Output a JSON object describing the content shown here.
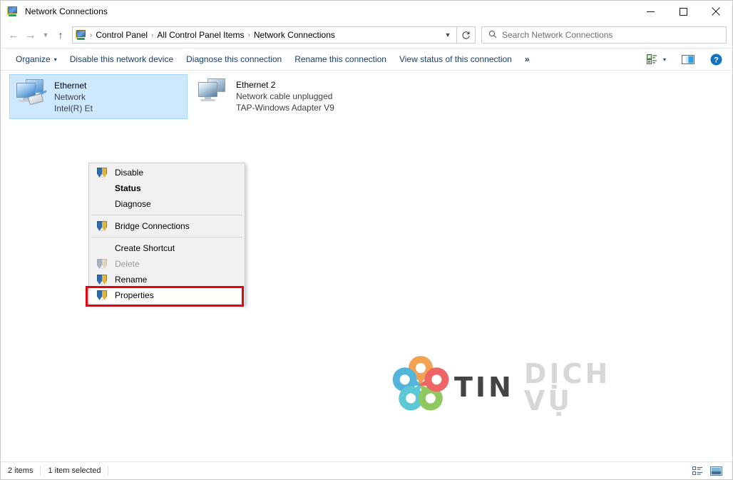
{
  "window": {
    "title": "Network Connections",
    "title_icon": "network-connections-icon",
    "minimize": "minimize-icon",
    "maximize": "maximize-icon",
    "close": "close-icon"
  },
  "navigation": {
    "back": "back-arrow-icon",
    "forward": "forward-arrow-icon",
    "recent": "recent-locations-icon",
    "up": "up-arrow-icon",
    "breadcrumb": {
      "icon": "network-connections-icon",
      "segments": [
        "Control Panel",
        "All Control Panel Items",
        "Network Connections"
      ],
      "separator": "›",
      "dropdown": "chevron-down-icon"
    },
    "refresh": "refresh-icon"
  },
  "search": {
    "icon": "search-icon",
    "placeholder": "Search Network Connections",
    "value": ""
  },
  "command_bar": {
    "organize": "Organize",
    "organize_caret": "▾",
    "items": [
      "Disable this network device",
      "Diagnose this connection",
      "Rename this connection",
      "View status of this connection"
    ],
    "overflow": "»",
    "change_view_icon": "change-view-icon",
    "change_view_caret": "▾",
    "preview_pane_icon": "preview-pane-icon",
    "help_icon": "help-icon"
  },
  "connections": [
    {
      "name": "Ethernet",
      "status": "Network",
      "device": "Intel(R) Et",
      "icon": "network-adapter-icon",
      "selected": true
    },
    {
      "name": "Ethernet 2",
      "status": "Network cable unplugged",
      "device": "TAP-Windows Adapter V9",
      "icon": "network-adapter-disconnected-icon",
      "selected": false
    }
  ],
  "context_menu": {
    "items": [
      {
        "label": "Disable",
        "icon": "uac-shield-icon",
        "bold": false,
        "disabled": false,
        "highlighted": false,
        "separator_after": false
      },
      {
        "label": "Status",
        "icon": "none",
        "bold": true,
        "disabled": false,
        "highlighted": false,
        "separator_after": false
      },
      {
        "label": "Diagnose",
        "icon": "none",
        "bold": false,
        "disabled": false,
        "highlighted": false,
        "separator_after": true
      },
      {
        "label": "Bridge Connections",
        "icon": "uac-shield-icon",
        "bold": false,
        "disabled": false,
        "highlighted": false,
        "separator_after": true
      },
      {
        "label": "Create Shortcut",
        "icon": "none",
        "bold": false,
        "disabled": false,
        "highlighted": false,
        "separator_after": false
      },
      {
        "label": "Delete",
        "icon": "uac-shield-icon",
        "bold": false,
        "disabled": true,
        "highlighted": false,
        "separator_after": false
      },
      {
        "label": "Rename",
        "icon": "uac-shield-icon",
        "bold": false,
        "disabled": false,
        "highlighted": false,
        "separator_after": false
      },
      {
        "label": "Properties",
        "icon": "uac-shield-icon",
        "bold": false,
        "disabled": false,
        "highlighted": true,
        "separator_after": false
      }
    ],
    "highlight_color": "#e8000d"
  },
  "watermark": {
    "text_primary": "TIN",
    "text_secondary": "DỊCH VỤ",
    "logo": "tindichvu-logo",
    "pin_colors": [
      "#f2a04d",
      "#4fb3d9",
      "#57c7d4",
      "#8cc75a",
      "#ef5f5f"
    ]
  },
  "status_bar": {
    "item_count": "2 items",
    "selection": "1 item selected",
    "details_view_icon": "details-view-icon",
    "large_icons_view_icon": "large-icons-view-icon"
  }
}
